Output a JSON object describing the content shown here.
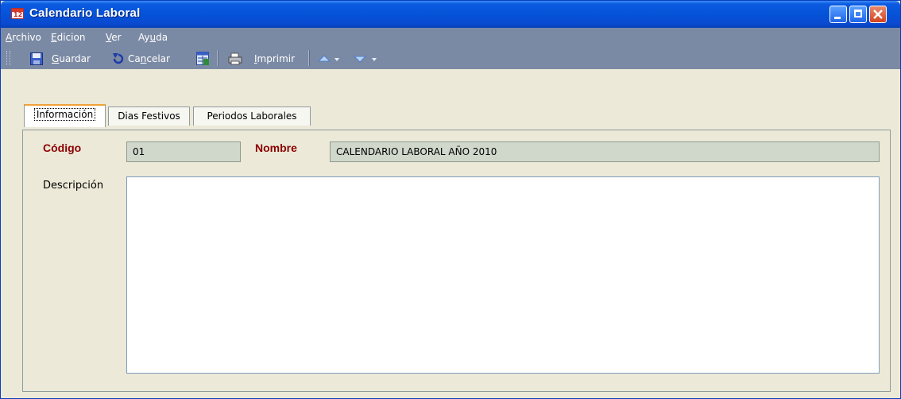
{
  "window": {
    "title": "Calendario Laboral",
    "icon_text": "12",
    "controls": [
      "minimize",
      "maximize",
      "close"
    ]
  },
  "menu": {
    "items": [
      {
        "pre": "",
        "ul": "A",
        "post": "rchivo"
      },
      {
        "pre": "",
        "ul": "E",
        "post": "dicion"
      },
      {
        "pre": "",
        "ul": "V",
        "post": "er"
      },
      {
        "pre": "Ay",
        "ul": "u",
        "post": "da"
      }
    ]
  },
  "toolbar": {
    "guardar": {
      "ul": "G",
      "post": "uardar"
    },
    "cancelar": {
      "pre": "Ca",
      "ul": "n",
      "post": "celar"
    },
    "imprimir": {
      "ul": "I",
      "post": "mprimir"
    }
  },
  "tabs": [
    {
      "label": "Información",
      "active": true
    },
    {
      "label": "Dias Festivos",
      "active": false
    },
    {
      "label": "Periodos Laborales",
      "active": false
    }
  ],
  "form": {
    "codigo_label": "Código",
    "codigo_value": "01",
    "nombre_label": "Nombre",
    "nombre_value": "CALENDARIO LABORAL AÑO 2010",
    "descripcion_label": "Descripción",
    "descripcion_value": ""
  },
  "colors": {
    "required_label": "#8b0000",
    "readonly_field": "#cfd8cb",
    "toolbar_bg": "#7b8aa4",
    "active_tab_accent": "#f0a238"
  }
}
